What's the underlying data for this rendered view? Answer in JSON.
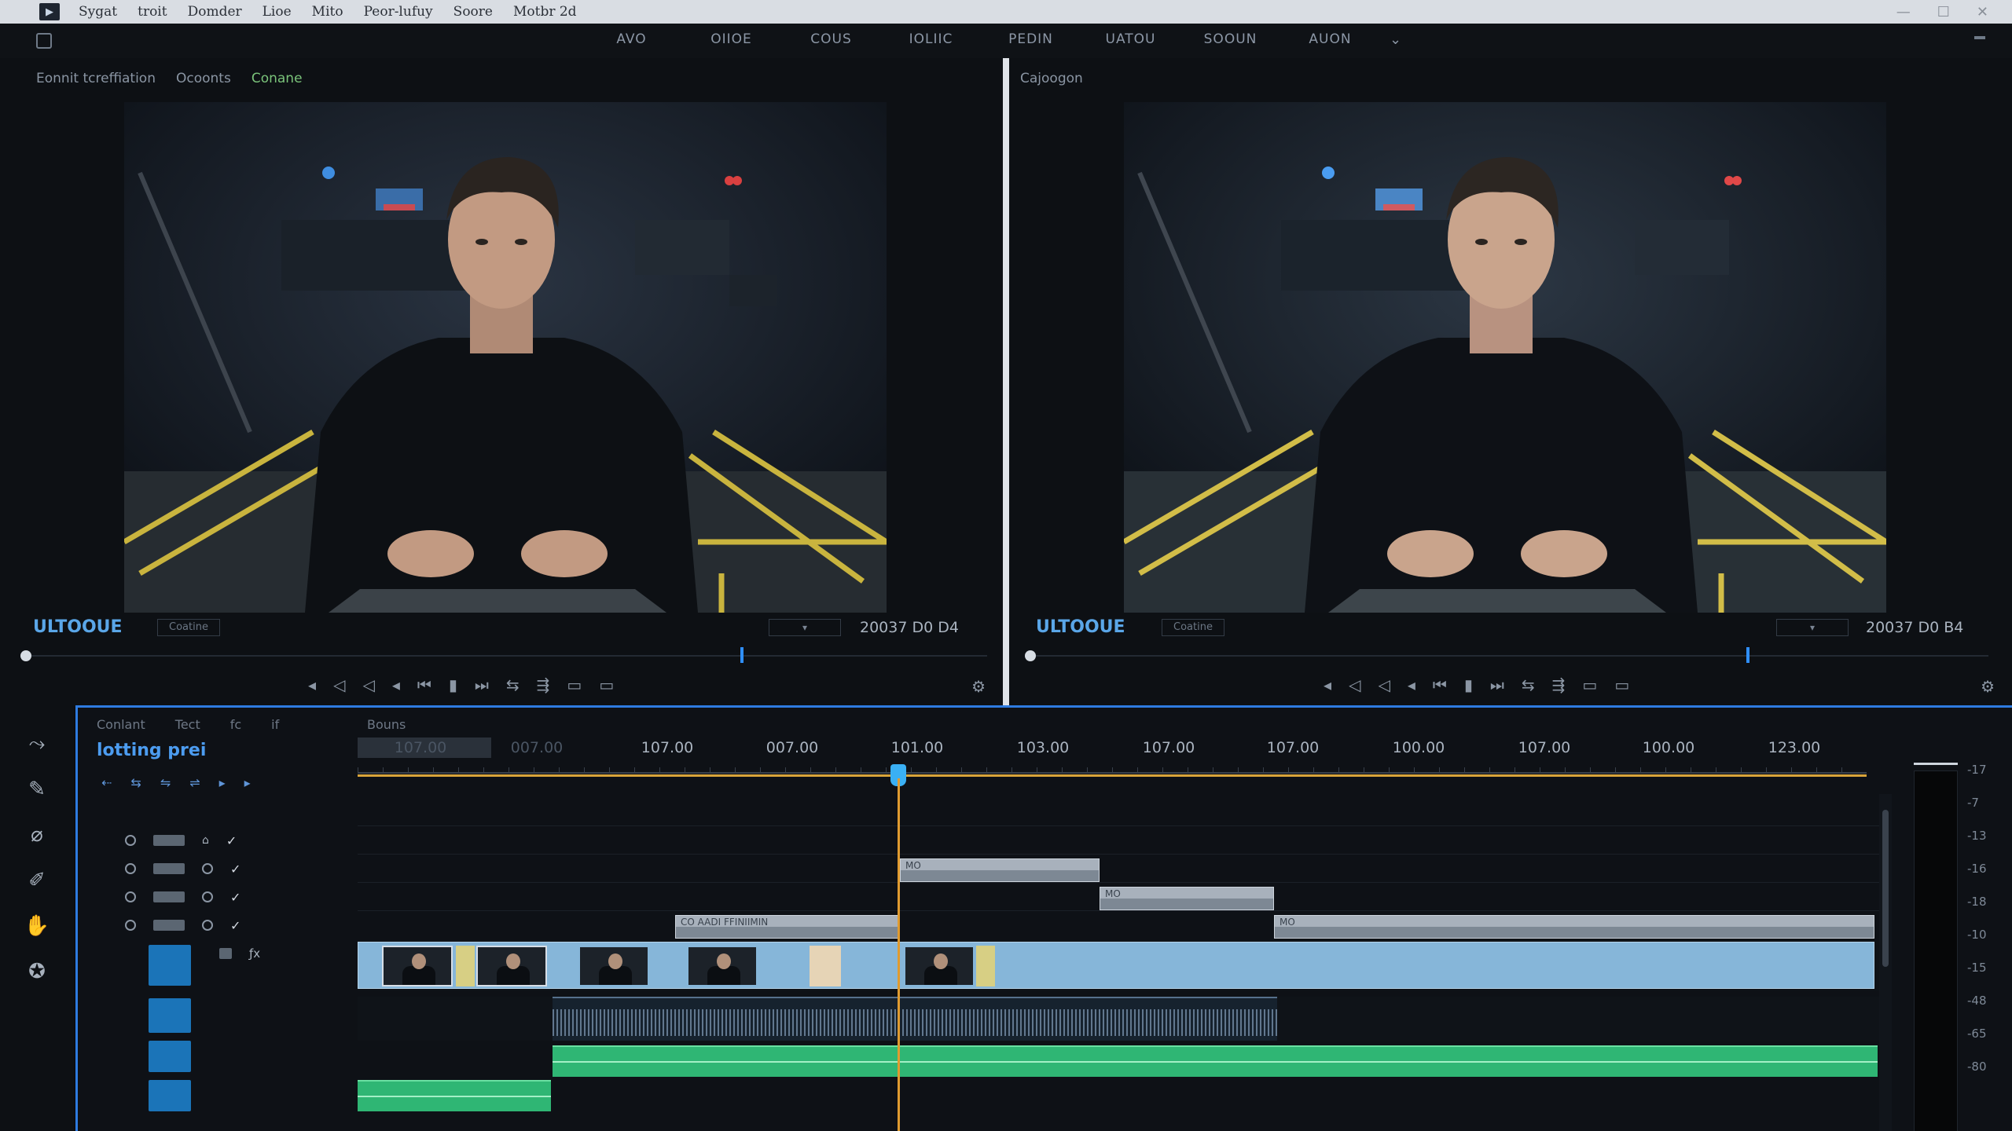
{
  "menubar": {
    "items": [
      "Sygat",
      "troit",
      "Domder",
      "Lioe",
      "Mito",
      "Peor-lufuy",
      "Soore",
      "Motbr 2d"
    ],
    "window_controls": [
      "—",
      "☐",
      "✕"
    ]
  },
  "workspace": {
    "tabs": [
      "AVO",
      "OIIOE",
      "COUS",
      "IOLIIC",
      "PEDIN",
      "UATOU",
      "SOOUN",
      "AUON"
    ],
    "chevron": "⌄"
  },
  "source_monitor": {
    "tabs": [
      "Eonnit tcreffiation",
      "Ocoonts",
      "Conane"
    ],
    "title": "ULTOOUE",
    "badge": "Coatine",
    "dropdown": "▾",
    "timecode": "20037 D0 D4"
  },
  "program_monitor": {
    "tabs": [
      "Cajoogon"
    ],
    "title": "ULTOOUE",
    "badge": "Coatine",
    "dropdown": "▾",
    "timecode": "20037 D0 B4"
  },
  "transport": [
    "◂",
    "◁",
    "◁",
    "◂",
    "⏮",
    "▮",
    "⏭",
    "⇆",
    "⇶",
    "▭",
    "▭"
  ],
  "timeline": {
    "header_tabs": [
      "Conlant",
      "Tect",
      "fc",
      "if"
    ],
    "panel_tab": "Bouns",
    "sequence_name": "lotting prei",
    "tools": [
      "⇠",
      "⇆",
      "⇋",
      "⇌",
      "▸",
      "▸"
    ],
    "ruler_labels": [
      "107.00",
      "007.00",
      "101.00",
      "103.00",
      "107.00",
      "107.00",
      "100.00",
      "107.00",
      "100.00",
      "123.00"
    ],
    "ruler_band_labels": [
      "107.00",
      "007.00"
    ],
    "clip_labels": [
      "CO AADI FFINIIMIN",
      "MO",
      "MO",
      "MO"
    ],
    "meter_scale": [
      "-17",
      "-7",
      "-13",
      "-16",
      "-18",
      "-10",
      "-15",
      "-48",
      "-65",
      "-80"
    ],
    "colors": {
      "accent": "#2e7be0",
      "playhead": "#e09b30",
      "video_clip": "#86b6d9",
      "audio_clip": "#2fb674"
    }
  }
}
